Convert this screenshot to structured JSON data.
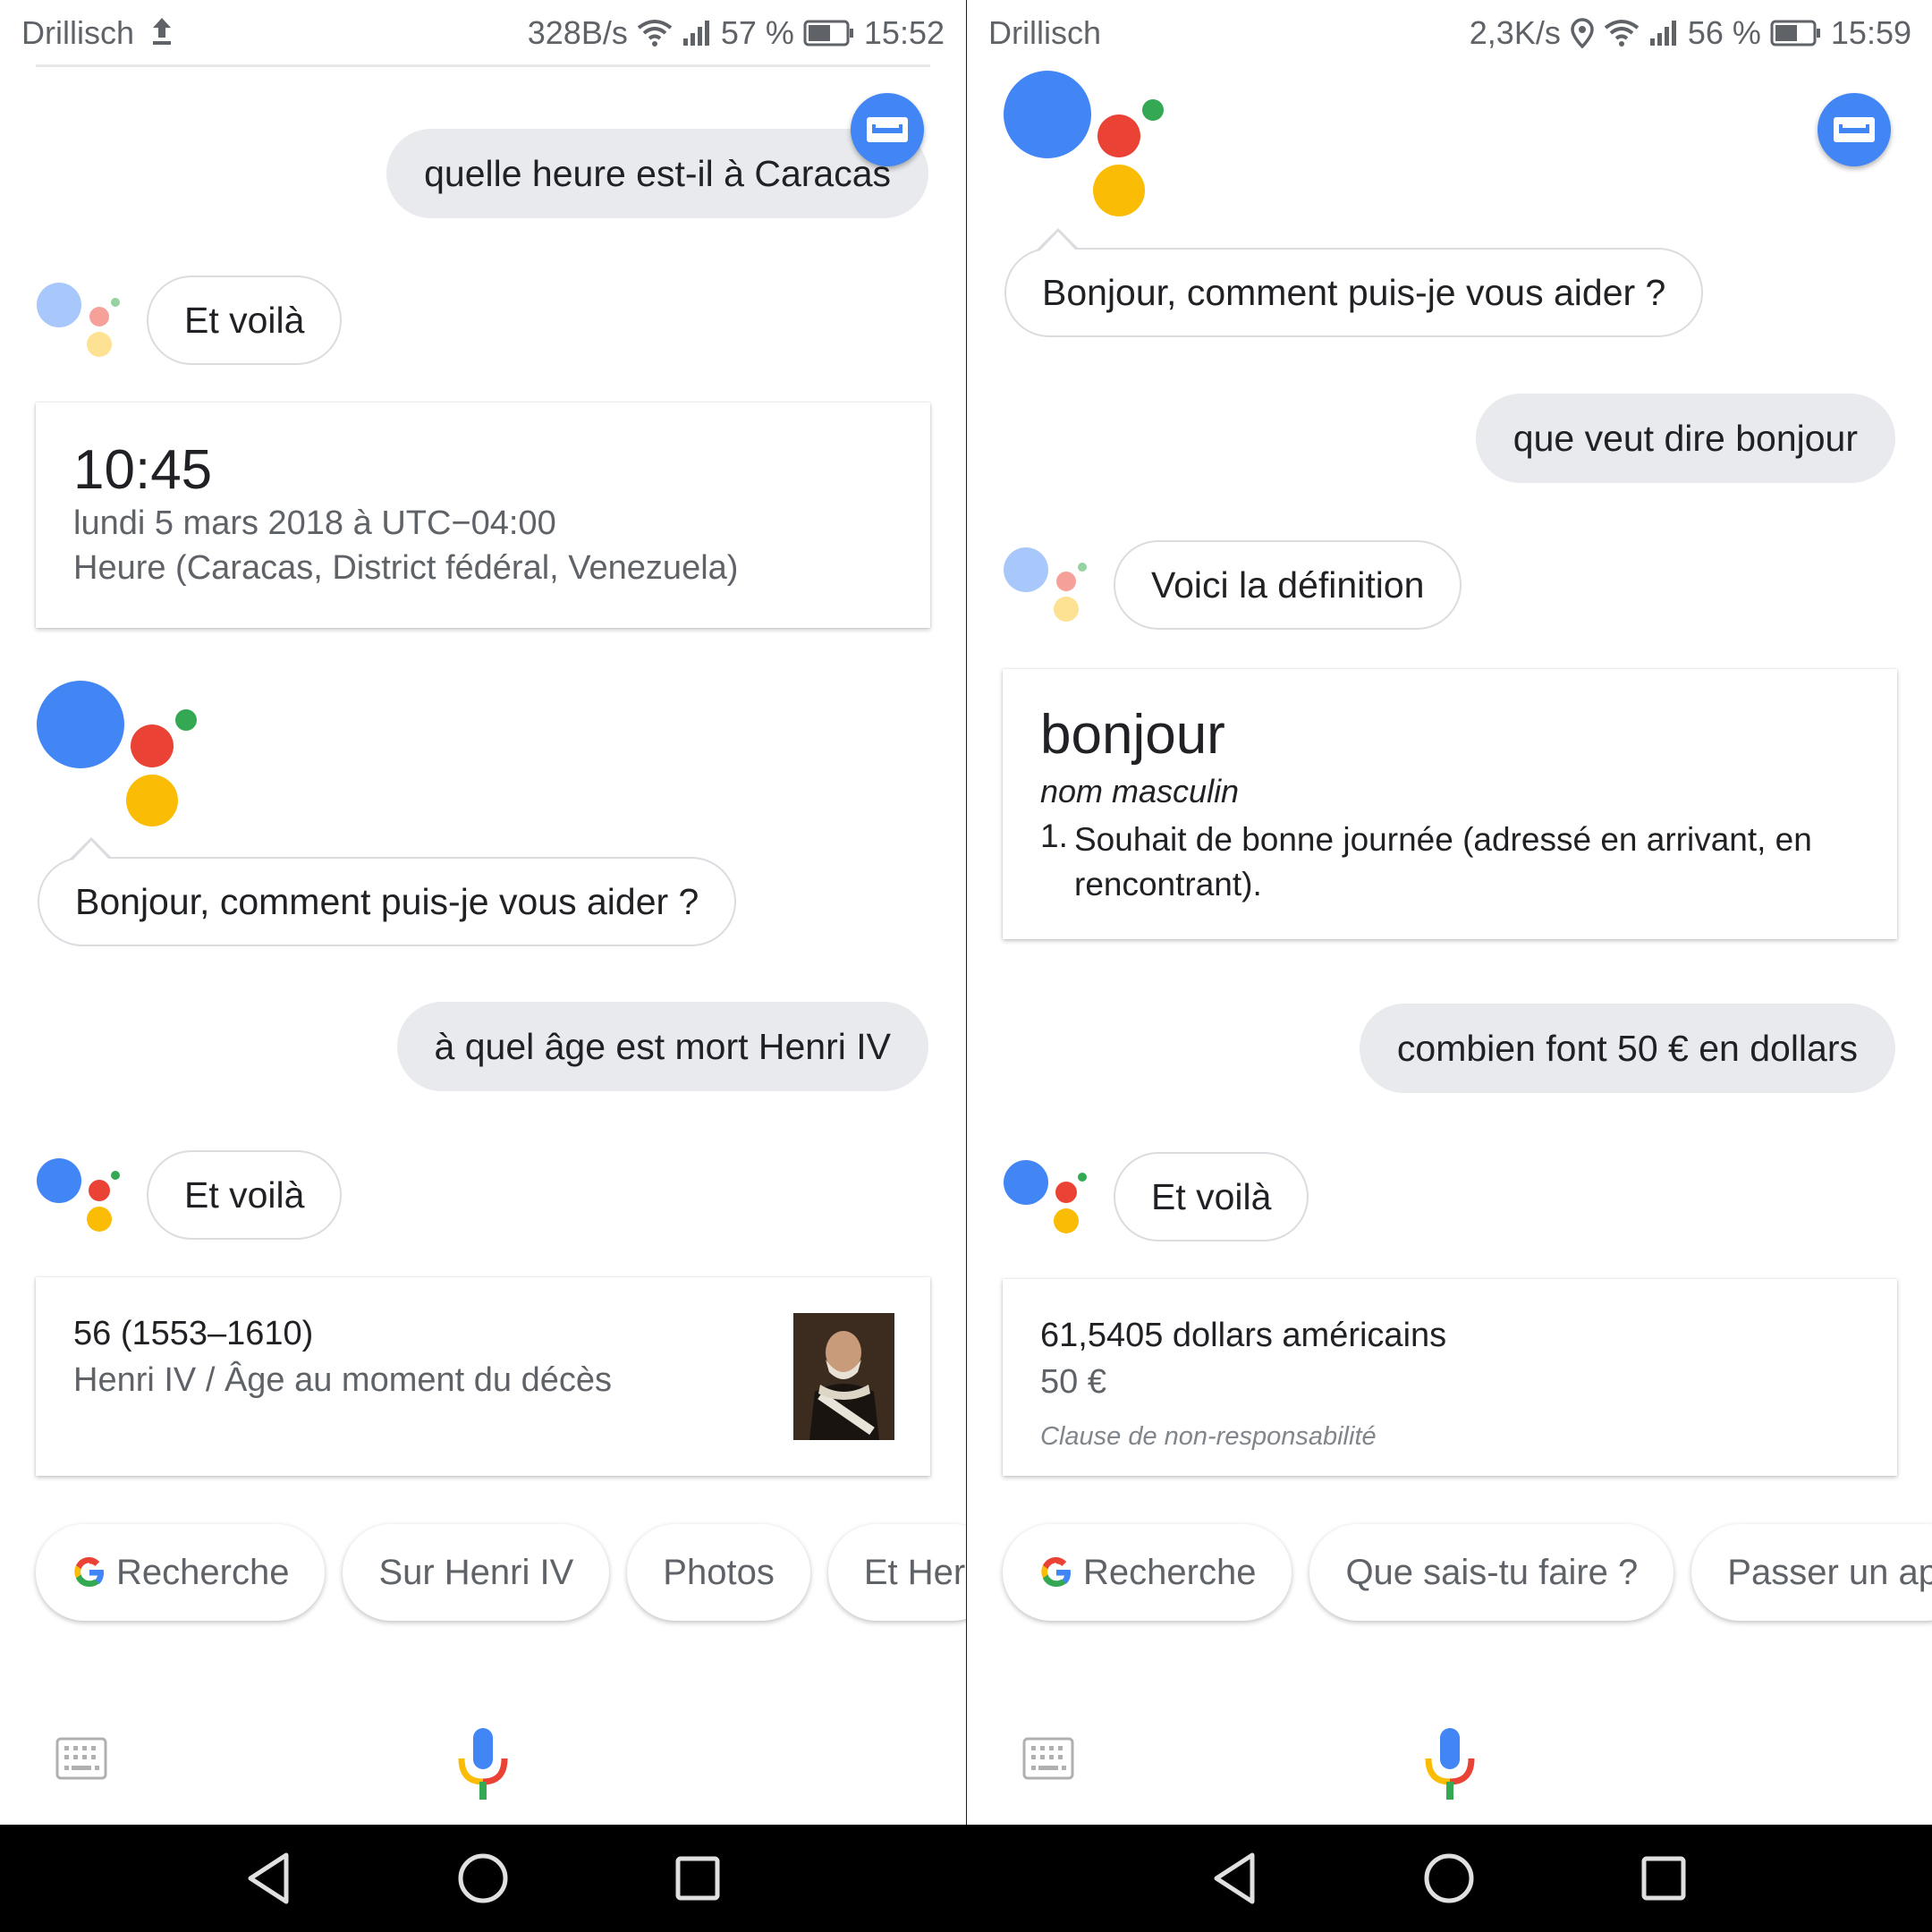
{
  "colors": {
    "blue": "#4285f4",
    "red": "#ea4335",
    "yellow": "#fbbc05",
    "green": "#34a853",
    "bubble": "#e8eaed",
    "muted": "#5f6368"
  },
  "left": {
    "status": {
      "carrier": "Drillisch",
      "speed": "328B/s",
      "battery": "57 %",
      "time": "15:52"
    },
    "query1": "quelle heure est-il à Caracas",
    "reply1": "Et voilà",
    "time_card": {
      "time": "10:45",
      "date": "lundi 5 mars 2018 à UTC−04:00",
      "place": "Heure (Caracas, District fédéral, Venezuela)"
    },
    "greeting": "Bonjour, comment puis-je vous aider ?",
    "query2": "à quel âge est mort Henri IV",
    "reply2": "Et voilà",
    "age_card": {
      "value": "56 (1553–1610)",
      "subtitle": "Henri IV / Âge au moment du décès"
    },
    "chips": [
      "Recherche",
      "Sur Henri IV",
      "Photos",
      "Et Her"
    ]
  },
  "right": {
    "status": {
      "carrier": "Drillisch",
      "speed": "2,3K/s",
      "battery": "56 %",
      "time": "15:59"
    },
    "greeting": "Bonjour, comment puis-je vous aider ?",
    "query1": "que veut dire bonjour",
    "reply1": "Voici la définition",
    "def_card": {
      "word": "bonjour",
      "pos": "nom masculin",
      "num": "1.",
      "definition": "Souhait de bonne journée (adressé en arrivant, en rencontrant)."
    },
    "query2": "combien font 50 € en dollars",
    "reply2": "Et voilà",
    "currency_card": {
      "result": "61,5405 dollars américains",
      "input": "50 €",
      "disclaimer": "Clause de non-responsabilité"
    },
    "chips": [
      "Recherche",
      "Que sais-tu faire ?",
      "Passer un ap"
    ]
  }
}
